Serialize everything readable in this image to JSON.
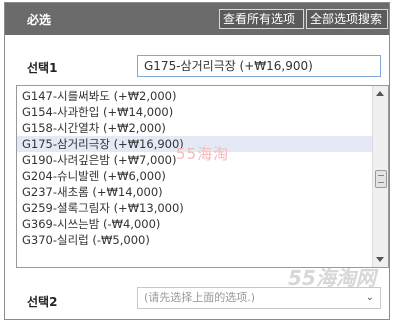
{
  "dialog": {
    "title": "必选",
    "view_all_label": "查看所有选项",
    "search_all_label": "全部选项搜索",
    "close_symbol": "✕"
  },
  "option1": {
    "label": "선택1",
    "selected_value": "G175-삼거리극장 (+₩16,900)"
  },
  "list": {
    "items": [
      "G147-시를써봐도 (+₩2,000)",
      "G154-사과한입 (+₩14,000)",
      "G158-시간열차 (+₩2,000)",
      "G175-삼거리극장 (+₩16,900)",
      "G190-사려깊은밤 (+₩7,000)",
      "G204-슈니발렌 (+₩6,000)",
      "G237-새초롬 (+₩14,000)",
      "G259-셜록그림자 (+₩13,000)",
      "G369-시쓰는밤 (-₩4,000)",
      "G370-실리럽 (-₩5,000)"
    ],
    "selected_index": 3
  },
  "option2": {
    "label": "선택2",
    "placeholder": "(请先选择上面的选项.)",
    "chevron_icon": "chevron-down-icon"
  },
  "watermarks": {
    "center": "55海淘",
    "corner": "55海淘网"
  }
}
